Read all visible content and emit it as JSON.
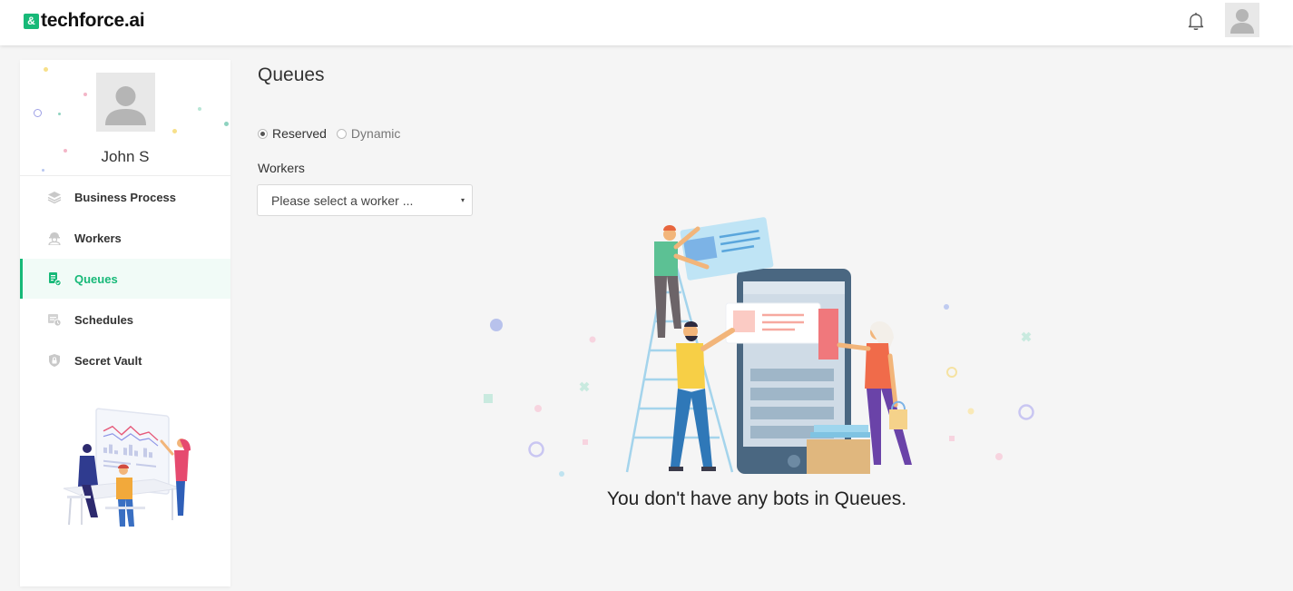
{
  "brand": {
    "logo_mark": "&",
    "name": "techforce.ai",
    "accent": "#17b978"
  },
  "header": {
    "icons": [
      "bell-icon",
      "user-avatar-icon"
    ]
  },
  "profile": {
    "name": "John S"
  },
  "sidebar": {
    "items": [
      {
        "label": "Business Process",
        "icon": "layers-icon",
        "active": false
      },
      {
        "label": "Workers",
        "icon": "worker-icon",
        "active": false
      },
      {
        "label": "Queues",
        "icon": "queue-icon",
        "active": true
      },
      {
        "label": "Schedules",
        "icon": "schedule-icon",
        "active": false
      },
      {
        "label": "Secret Vault",
        "icon": "shield-lock-icon",
        "active": false
      }
    ]
  },
  "main": {
    "title": "Queues",
    "mode": {
      "options": [
        "Reserved",
        "Dynamic"
      ],
      "selected": "Reserved"
    },
    "workers_label": "Workers",
    "worker_select": {
      "placeholder": "Please select a worker ...",
      "arrow": "▾"
    },
    "empty_message": "You don't have any bots in Queues."
  }
}
